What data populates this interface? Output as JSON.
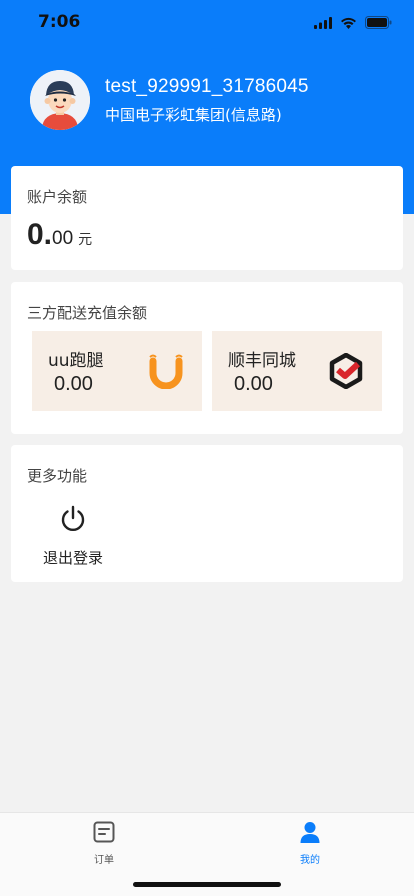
{
  "status_bar": {
    "time": "7:06"
  },
  "profile": {
    "username": "test_929991_31786045",
    "company": "中国电子彩虹集团(信息路)"
  },
  "balance": {
    "title": "账户余额",
    "amount_int": "0.",
    "amount_dec": "00",
    "unit": "元"
  },
  "third_party": {
    "title": "三方配送充值余额",
    "items": [
      {
        "name": "uu跑腿",
        "amount": "0.00",
        "icon": "uu-logo-icon"
      },
      {
        "name": "顺丰同城",
        "amount": "0.00",
        "icon": "sf-logo-icon"
      }
    ]
  },
  "more": {
    "title": "更多功能",
    "logout_label": "退出登录"
  },
  "tabbar": {
    "items": [
      {
        "label": "订单",
        "icon": "document-icon",
        "active": false
      },
      {
        "label": "我的",
        "icon": "person-icon",
        "active": true
      }
    ],
    "active_color": "#0a7dfa",
    "inactive_color": "#555555"
  },
  "colors": {
    "brand": "#0a7dfa",
    "sub_card_bg": "#f7eee6",
    "uu_orange": "#f7931e",
    "sf_red": "#d9262b"
  }
}
